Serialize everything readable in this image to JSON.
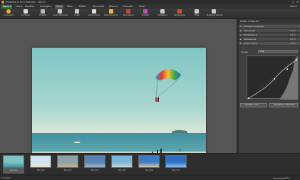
{
  "window": {
    "title": "PhotoPad di NCH Software - 4BCC9",
    "minimize": "–",
    "maximize": "□",
    "close": "✕"
  },
  "menu": {
    "file": "Menu ▾",
    "items": [
      "Home",
      "Modifica",
      "Immagine",
      "Colore",
      "Filtro",
      "Effetti",
      "Strumenti",
      "Ritocca",
      "Controlla",
      "Suite"
    ],
    "active_index": 3,
    "right": "Nuovo"
  },
  "toolbar": [
    {
      "label": "Luminosità",
      "icon": "sun-icon",
      "color": "#f0b030"
    },
    {
      "label": "Contrasto",
      "icon": "contrast-icon",
      "color": "#dddddd"
    },
    {
      "label": "Tonalità",
      "icon": "histogram-icon",
      "color": "#bbbbbb"
    },
    {
      "label": "Livelli automatici",
      "icon": "levels-auto-icon",
      "color": "#cccccc"
    },
    {
      "label": "Livelli",
      "icon": "levels-icon",
      "color": "#cccccc"
    },
    {
      "label": "Curve colore",
      "icon": "curves-icon",
      "color": "#dddddd"
    },
    {
      "label": "Bilancia colore",
      "icon": "balance-icon",
      "color": "#e0c040"
    },
    {
      "label": "Saturazione",
      "icon": "saturation-icon",
      "color": "#d04040"
    },
    {
      "label": "Tonalità",
      "icon": "color-wheel-icon",
      "color": "#c050c0"
    },
    {
      "label": "Sfumatura",
      "icon": "tint-icon",
      "color": "#cccccc"
    },
    {
      "label": "Temperatura",
      "icon": "thermometer-icon",
      "color": "#d05030"
    },
    {
      "label": "Tinta",
      "icon": "tint-drop-icon",
      "color": "#cccccc"
    },
    {
      "label": "Mappa Gradiente",
      "icon": "gradient-map-icon",
      "color": "#cccccc"
    }
  ],
  "panel": {
    "header": "Effetti e Ritocchi",
    "rows": [
      {
        "label": "Immagine originale",
        "value": "",
        "open": true
      },
      {
        "label": "Luminosità",
        "value": "100%"
      },
      {
        "label": "Temperatura",
        "value": "100%"
      },
      {
        "label": "Saturazione",
        "value": "100%"
      },
      {
        "label": "Curve colore",
        "value": "100%",
        "open": true
      }
    ],
    "canale_label": "Canale",
    "canale_value": "RGB",
    "btn_reset": "Ripristina curva",
    "btn_auto": "Regolazione Automatica"
  },
  "filmstrip": [
    {
      "name": "IMG_001",
      "selected": true,
      "colors": [
        "#7fc4c4",
        "#3f8fa0"
      ]
    },
    {
      "name": "IMG_002",
      "colors": [
        "#cfe3f0",
        "#e9e2d0"
      ]
    },
    {
      "name": "IMG_003",
      "colors": [
        "#8aa2a8",
        "#c7b08e"
      ]
    },
    {
      "name": "IMG_004",
      "colors": [
        "#5a83b5",
        "#a0b8c8"
      ]
    },
    {
      "name": "IMG_005",
      "colors": [
        "#7ab4d8",
        "#c9d8cf"
      ]
    },
    {
      "name": "IMG_006",
      "colors": [
        "#3f7bc4",
        "#d8c9a0"
      ]
    },
    {
      "name": "IMG_007",
      "colors": [
        "#2e6fc2",
        "#8ec0e8"
      ]
    }
  ],
  "status": {
    "left": "PhotoPad",
    "zoom": "100%"
  }
}
